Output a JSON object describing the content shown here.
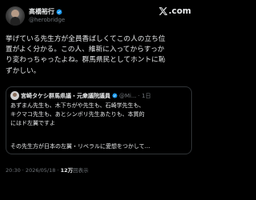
{
  "author": {
    "name": "高橋裕行",
    "handle": "@herobridge"
  },
  "brand": {
    "logo_text": ".com",
    "logo_icon": "x-logo-icon"
  },
  "tweet": {
    "lines": [
      "挙げている先生方が全員香ばしくてこの人の立ち位",
      "置がよく分かる。この人、維新に入ってからすっか",
      "り変わっちゃったよね。群馬県民としてホントに恥",
      "ずかしい。"
    ]
  },
  "quote": {
    "name": "宮崎タケシ群馬県議・元衆議院議員",
    "handle": "@Mi...",
    "time": "· 1日",
    "lines": [
      "あずまん先生も、木下ちがや先生も、石崎学先生も、",
      "キクマコ先生も、あとシンボリ先生あたりも、本質的",
      "にはド左翼ですよ"
    ],
    "more": "その先生方が日本の左翼・リベラルに愛想をつかして..."
  },
  "meta": {
    "time": "20:30 · 2026/05/18 · ",
    "views_count": "12万",
    "views_label": "回表示"
  },
  "colors": {
    "background": "#000000",
    "text": "#e7e9ea",
    "muted": "#71767b",
    "verified": "#1d9bf0",
    "border": "#2f3336"
  }
}
